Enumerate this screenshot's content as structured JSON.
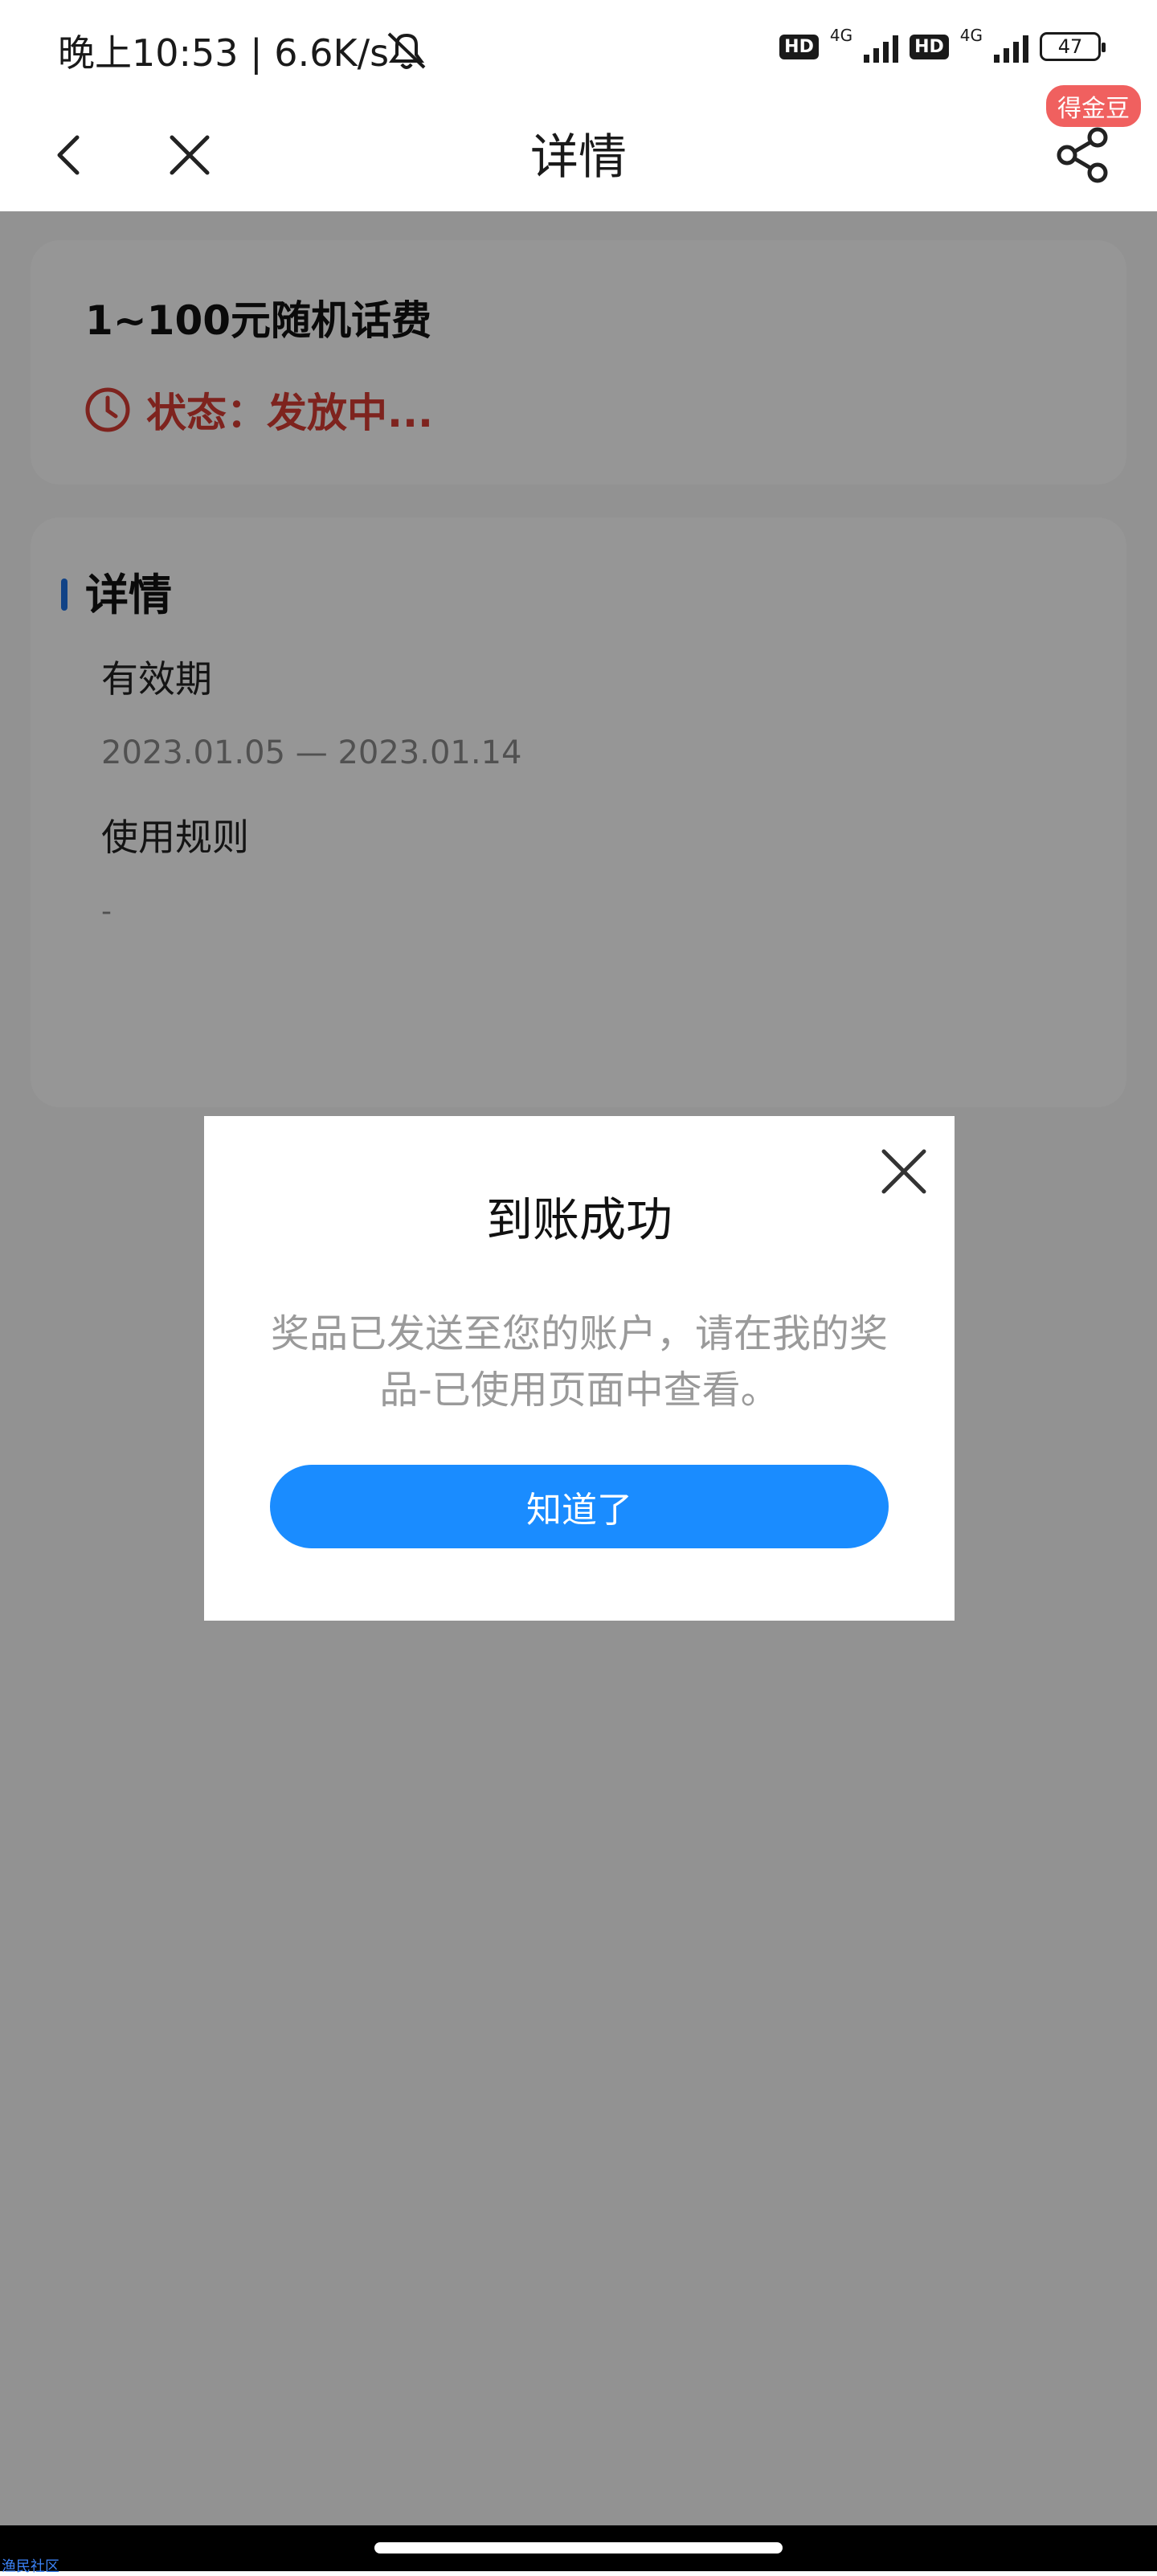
{
  "status_bar": {
    "time": "晚上10:53 | 6.6K/s",
    "hd1": "HD",
    "net1": "4G",
    "hd2": "HD",
    "net2": "4G",
    "battery": "47"
  },
  "header": {
    "title": "详情",
    "badge": "得金豆"
  },
  "prize": {
    "title": "1~100元随机话费",
    "status": "状态：发放中...",
    "status_color": "#d33b33"
  },
  "details": {
    "section_title": "详情",
    "validity_label": "有效期",
    "validity_value": "2023.01.05 — 2023.01.14",
    "rules_label": "使用规则",
    "rules_value": "-"
  },
  "dialog": {
    "title": "到账成功",
    "message": "奖品已发送至您的账户，请在我的奖品-已使用页面中查看。",
    "button_label": "知道了",
    "button_color": "#1a8cff"
  },
  "watermark": "渔民社区"
}
